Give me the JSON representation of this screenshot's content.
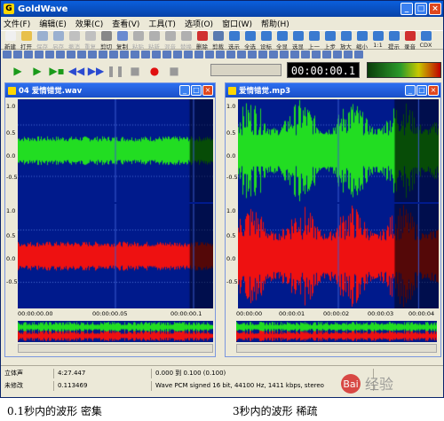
{
  "app": {
    "title": "GoldWave",
    "min_icon": "minimize-icon",
    "max_icon": "maximize-icon",
    "close_icon": "close-icon"
  },
  "menu": [
    "文件(F)",
    "编辑(E)",
    "效果(C)",
    "查看(V)",
    "工具(T)",
    "选项(O)",
    "窗口(W)",
    "帮助(H)"
  ],
  "toolbar": [
    {
      "label": "新建",
      "color": "#f0f0f0"
    },
    {
      "label": "打开",
      "color": "#e8c04a"
    },
    {
      "label": "保存",
      "color": "#9ab0d0",
      "disabled": true
    },
    {
      "label": "另存",
      "color": "#9ab0d0",
      "disabled": true
    },
    {
      "label": "撤消",
      "color": "#c0c0c0",
      "disabled": true
    },
    {
      "label": "重复",
      "color": "#c0c0c0",
      "disabled": true
    },
    {
      "label": "剪切",
      "color": "#888888"
    },
    {
      "label": "复制",
      "color": "#6a8ad0"
    },
    {
      "label": "粘贴",
      "color": "#b0b0b0",
      "disabled": true
    },
    {
      "label": "粘新",
      "color": "#b0b0b0",
      "disabled": true
    },
    {
      "label": "混音",
      "color": "#b0b0b0",
      "disabled": true
    },
    {
      "label": "替换",
      "color": "#b0b0b0",
      "disabled": true
    },
    {
      "label": "删除",
      "color": "#d03030"
    },
    {
      "label": "剪裁",
      "color": "#5a7ab0"
    },
    {
      "label": "选示",
      "color": "#3a7ad0"
    },
    {
      "label": "全选",
      "color": "#3a7ad0"
    },
    {
      "label": "设标",
      "color": "#3a7ad0"
    },
    {
      "label": "全显",
      "color": "#3a7ad0"
    },
    {
      "label": "选显",
      "color": "#3a7ad0"
    },
    {
      "label": "上一",
      "color": "#3a7ad0"
    },
    {
      "label": "上步",
      "color": "#3a7ad0"
    },
    {
      "label": "放大",
      "color": "#3a7ad0"
    },
    {
      "label": "缩小",
      "color": "#3a7ad0"
    },
    {
      "label": "1:1",
      "color": "#3a7ad0"
    },
    {
      "label": "提示",
      "color": "#3a7ad0"
    },
    {
      "label": "录音",
      "color": "#d03030"
    },
    {
      "label": "CDX",
      "color": "#3a7ad0"
    }
  ],
  "time_display": "00:00:00.1",
  "windows": [
    {
      "title": "04 爱情错觉.wav",
      "channel1_labels": [
        "1.0",
        "0.5",
        "0.0",
        "-0.5"
      ],
      "channel2_labels": [
        "1.0",
        "0.5",
        "0.0",
        "-0.5"
      ],
      "time_labels": [
        "00:00:00.00",
        "00:00:00.05",
        "00:00:00.1"
      ]
    },
    {
      "title": "爱情错觉.mp3",
      "channel1_labels": [
        "1.0",
        "0.5",
        "0.0",
        "-0.5"
      ],
      "channel2_labels": [
        "1.0",
        "0.5",
        "0.0",
        "-0.5"
      ],
      "time_labels": [
        "00:00:00",
        "00:00:01",
        "00:00:02",
        "00:00:03",
        "00:00:04"
      ]
    }
  ],
  "status": {
    "row1": [
      "立体声",
      "4:27.447",
      "0.000 到 0.100 (0.100)"
    ],
    "row2": [
      "未修改",
      "0.113469",
      "Wave PCM signed 16 bit, 44100 Hz, 1411 kbps, stereo"
    ]
  },
  "watermark": "经验",
  "captions": {
    "left": "0.1秒内的波形  密集",
    "right": "3秒内的波形  稀疏"
  },
  "colors": {
    "wave_bg": "#001a8c",
    "left_channel": "#22dd22",
    "right_channel": "#ee1111"
  }
}
